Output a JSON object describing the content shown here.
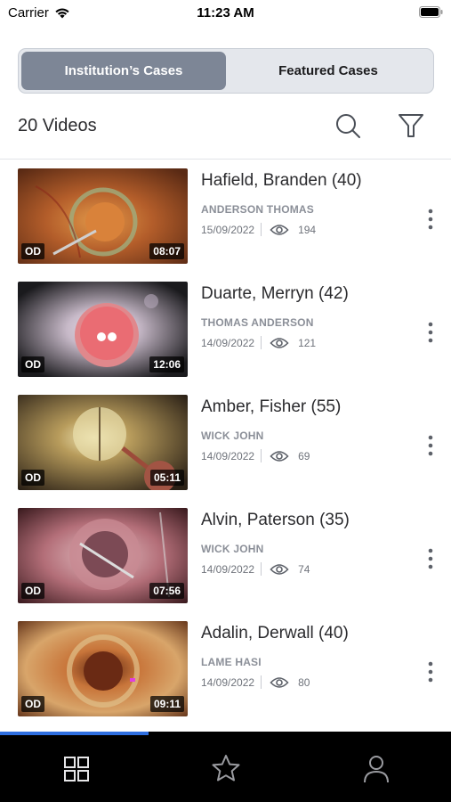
{
  "status_bar": {
    "carrier": "Carrier",
    "time": "11:23 AM"
  },
  "segments": {
    "institution_label": "Institution’s Cases",
    "featured_label": "Featured Cases",
    "selected": "institution"
  },
  "toolbar": {
    "video_count": "20 Videos",
    "search_icon": "search-icon",
    "filter_icon": "filter-icon"
  },
  "cases": [
    {
      "title": "Hafield, Branden (40)",
      "surgeon": "ANDERSON THOMAS",
      "date": "15/09/2022",
      "views": "194",
      "eye": "OD",
      "duration": "08:07"
    },
    {
      "title": "Duarte, Merryn (42)",
      "surgeon": "THOMAS ANDERSON",
      "date": "14/09/2022",
      "views": "121",
      "eye": "OD",
      "duration": "12:06"
    },
    {
      "title": "Amber, Fisher (55)",
      "surgeon": "WICK JOHN",
      "date": "14/09/2022",
      "views": "69",
      "eye": "OD",
      "duration": "05:11"
    },
    {
      "title": "Alvin, Paterson (35)",
      "surgeon": "WICK JOHN",
      "date": "14/09/2022",
      "views": "74",
      "eye": "OD",
      "duration": "07:56"
    },
    {
      "title": "Adalin, Derwall (40)",
      "surgeon": "LAME HASI",
      "date": "14/09/2022",
      "views": "80",
      "eye": "OD",
      "duration": "09:11"
    }
  ],
  "scroll_progress": 0.33,
  "tabbar": {
    "items": [
      "grid-icon",
      "star-icon",
      "person-icon"
    ],
    "selected": "grid-icon"
  },
  "colors": {
    "accent": "#2f6fe0",
    "segment_active": "#7d8696",
    "tabbar_bg": "#000000"
  }
}
